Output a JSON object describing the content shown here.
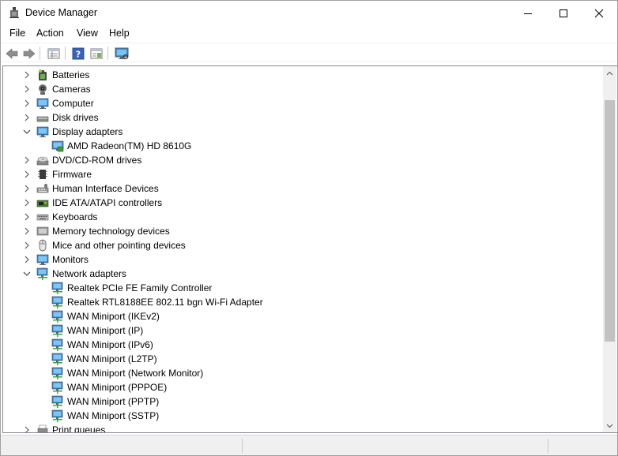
{
  "window": {
    "title": "Device Manager"
  },
  "menu": [
    {
      "label": "File"
    },
    {
      "label": "Action"
    },
    {
      "label": "View"
    },
    {
      "label": "Help"
    }
  ],
  "toolbar": [
    {
      "name": "back-button",
      "icon": "arrow-left-icon"
    },
    {
      "name": "forward-button",
      "icon": "arrow-right-icon"
    },
    {
      "name": "properties-button",
      "icon": "properties-icon"
    },
    {
      "name": "help-button",
      "icon": "help-icon"
    },
    {
      "name": "details-pane-button",
      "icon": "pane-icon"
    },
    {
      "name": "scan-hardware-button",
      "icon": "monitor-scan-icon"
    }
  ],
  "tree": [
    {
      "label": "Batteries",
      "level": 0,
      "expander": "collapsed",
      "icon": "battery-icon"
    },
    {
      "label": "Cameras",
      "level": 0,
      "expander": "collapsed",
      "icon": "camera-icon"
    },
    {
      "label": "Computer",
      "level": 0,
      "expander": "collapsed",
      "icon": "monitor-icon"
    },
    {
      "label": "Disk drives",
      "level": 0,
      "expander": "collapsed",
      "icon": "disk-icon"
    },
    {
      "label": "Display adapters",
      "level": 0,
      "expander": "expanded",
      "icon": "monitor-icon"
    },
    {
      "label": "AMD Radeon(TM) HD 8610G",
      "level": 1,
      "expander": "none",
      "icon": "display-adapter-icon"
    },
    {
      "label": "DVD/CD-ROM drives",
      "level": 0,
      "expander": "collapsed",
      "icon": "dvd-icon"
    },
    {
      "label": "Firmware",
      "level": 0,
      "expander": "collapsed",
      "icon": "chip-icon"
    },
    {
      "label": "Human Interface Devices",
      "level": 0,
      "expander": "collapsed",
      "icon": "hid-icon"
    },
    {
      "label": "IDE ATA/ATAPI controllers",
      "level": 0,
      "expander": "collapsed",
      "icon": "controller-icon"
    },
    {
      "label": "Keyboards",
      "level": 0,
      "expander": "collapsed",
      "icon": "keyboard-icon"
    },
    {
      "label": "Memory technology devices",
      "level": 0,
      "expander": "collapsed",
      "icon": "memory-icon"
    },
    {
      "label": "Mice and other pointing devices",
      "level": 0,
      "expander": "collapsed",
      "icon": "mouse-icon"
    },
    {
      "label": "Monitors",
      "level": 0,
      "expander": "collapsed",
      "icon": "monitor-icon"
    },
    {
      "label": "Network adapters",
      "level": 0,
      "expander": "expanded",
      "icon": "network-icon"
    },
    {
      "label": "Realtek PCIe FE Family Controller",
      "level": 1,
      "expander": "none",
      "icon": "network-icon"
    },
    {
      "label": "Realtek RTL8188EE 802.11 bgn Wi-Fi Adapter",
      "level": 1,
      "expander": "none",
      "icon": "network-icon"
    },
    {
      "label": "WAN Miniport (IKEv2)",
      "level": 1,
      "expander": "none",
      "icon": "network-icon"
    },
    {
      "label": "WAN Miniport (IP)",
      "level": 1,
      "expander": "none",
      "icon": "network-icon"
    },
    {
      "label": "WAN Miniport (IPv6)",
      "level": 1,
      "expander": "none",
      "icon": "network-icon"
    },
    {
      "label": "WAN Miniport (L2TP)",
      "level": 1,
      "expander": "none",
      "icon": "network-icon"
    },
    {
      "label": "WAN Miniport (Network Monitor)",
      "level": 1,
      "expander": "none",
      "icon": "network-icon"
    },
    {
      "label": "WAN Miniport (PPPOE)",
      "level": 1,
      "expander": "none",
      "icon": "network-icon"
    },
    {
      "label": "WAN Miniport (PPTP)",
      "level": 1,
      "expander": "none",
      "icon": "network-icon"
    },
    {
      "label": "WAN Miniport (SSTP)",
      "level": 1,
      "expander": "none",
      "icon": "network-icon"
    },
    {
      "label": "Print queues",
      "level": 0,
      "expander": "collapsed",
      "icon": "printer-icon"
    }
  ],
  "colors": {
    "accent": "#1e6fc8",
    "scroll_thumb": "#c2c2c2"
  }
}
